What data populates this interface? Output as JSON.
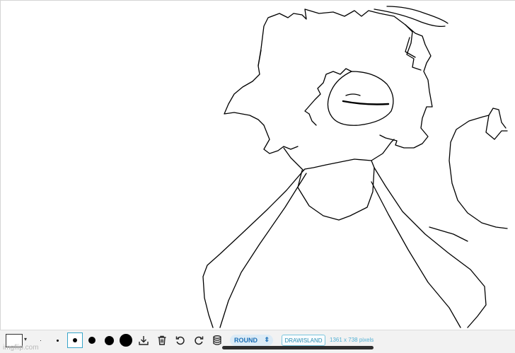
{
  "canvas": {
    "icon": "sketch-drawing-of-character"
  },
  "toolbar": {
    "color_picker": {
      "icon": "color-swatch",
      "color": "#ffffff",
      "caret": "▾"
    },
    "brushes": [
      {
        "name": "brush-size-1",
        "diameter": 1
      },
      {
        "name": "brush-size-3",
        "diameter": 3
      },
      {
        "name": "brush-size-6",
        "diameter": 6,
        "selected": true
      },
      {
        "name": "brush-size-10",
        "diameter": 10
      },
      {
        "name": "brush-size-13",
        "diameter": 13
      },
      {
        "name": "brush-size-18",
        "diameter": 18
      }
    ],
    "icons": [
      "download-icon",
      "trash-icon",
      "undo-icon",
      "redo-icon",
      "database-icon"
    ],
    "line_cap": {
      "value": "ROUND",
      "chevron": "⌃⌄"
    },
    "drawisland_label": "DRAWISLAND",
    "canvas_size": "1361 x 738 pixels",
    "watermark": "imgflip.com",
    "accent": "#38a5c9"
  }
}
